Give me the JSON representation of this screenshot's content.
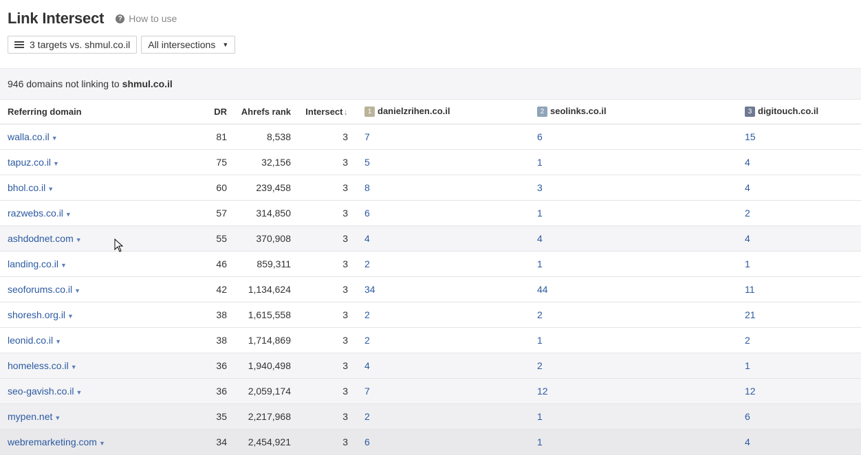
{
  "header": {
    "title": "Link Intersect",
    "how_to_use": "How to use"
  },
  "controls": {
    "targets_label": "3 targets vs. shmul.co.il",
    "intersections_label": "All intersections"
  },
  "summary": {
    "prefix": "946 domains not linking to",
    "target": "shmul.co.il"
  },
  "table": {
    "headers": {
      "domain": "Referring domain",
      "dr": "DR",
      "rank": "Ahrefs rank",
      "intersect": "Intersect",
      "sort_arrow": "↓",
      "t1_num": "1",
      "t1": "danielzrihen.co.il",
      "t2_num": "2",
      "t2": "seolinks.co.il",
      "t3_num": "3",
      "t3": "digitouch.co.il"
    },
    "badge_colors": {
      "t1": "#b9b39a",
      "t2": "#8fa4b8",
      "t3": "#6f7a92"
    },
    "rows": [
      {
        "domain": "walla.co.il",
        "dr": "81",
        "rank": "8,538",
        "intersect": "3",
        "t1": "7",
        "t2": "6",
        "t3": "15"
      },
      {
        "domain": "tapuz.co.il",
        "dr": "75",
        "rank": "32,156",
        "intersect": "3",
        "t1": "5",
        "t2": "1",
        "t3": "4"
      },
      {
        "domain": "bhol.co.il",
        "dr": "60",
        "rank": "239,458",
        "intersect": "3",
        "t1": "8",
        "t2": "3",
        "t3": "4"
      },
      {
        "domain": "razwebs.co.il",
        "dr": "57",
        "rank": "314,850",
        "intersect": "3",
        "t1": "6",
        "t2": "1",
        "t3": "2"
      },
      {
        "domain": "ashdodnet.com",
        "dr": "55",
        "rank": "370,908",
        "intersect": "3",
        "t1": "4",
        "t2": "4",
        "t3": "4"
      },
      {
        "domain": "landing.co.il",
        "dr": "46",
        "rank": "859,311",
        "intersect": "3",
        "t1": "2",
        "t2": "1",
        "t3": "1"
      },
      {
        "domain": "seoforums.co.il",
        "dr": "42",
        "rank": "1,134,624",
        "intersect": "3",
        "t1": "34",
        "t2": "44",
        "t3": "11"
      },
      {
        "domain": "shoresh.org.il",
        "dr": "38",
        "rank": "1,615,558",
        "intersect": "3",
        "t1": "2",
        "t2": "2",
        "t3": "21"
      },
      {
        "domain": "leonid.co.il",
        "dr": "38",
        "rank": "1,714,869",
        "intersect": "3",
        "t1": "2",
        "t2": "1",
        "t3": "2"
      },
      {
        "domain": "homeless.co.il",
        "dr": "36",
        "rank": "1,940,498",
        "intersect": "3",
        "t1": "4",
        "t2": "2",
        "t3": "1"
      },
      {
        "domain": "seo-gavish.co.il",
        "dr": "36",
        "rank": "2,059,174",
        "intersect": "3",
        "t1": "7",
        "t2": "12",
        "t3": "12"
      },
      {
        "domain": "mypen.net",
        "dr": "35",
        "rank": "2,217,968",
        "intersect": "3",
        "t1": "2",
        "t2": "1",
        "t3": "6"
      },
      {
        "domain": "webremarketing.com",
        "dr": "34",
        "rank": "2,454,921",
        "intersect": "3",
        "t1": "6",
        "t2": "1",
        "t3": "4"
      }
    ]
  }
}
